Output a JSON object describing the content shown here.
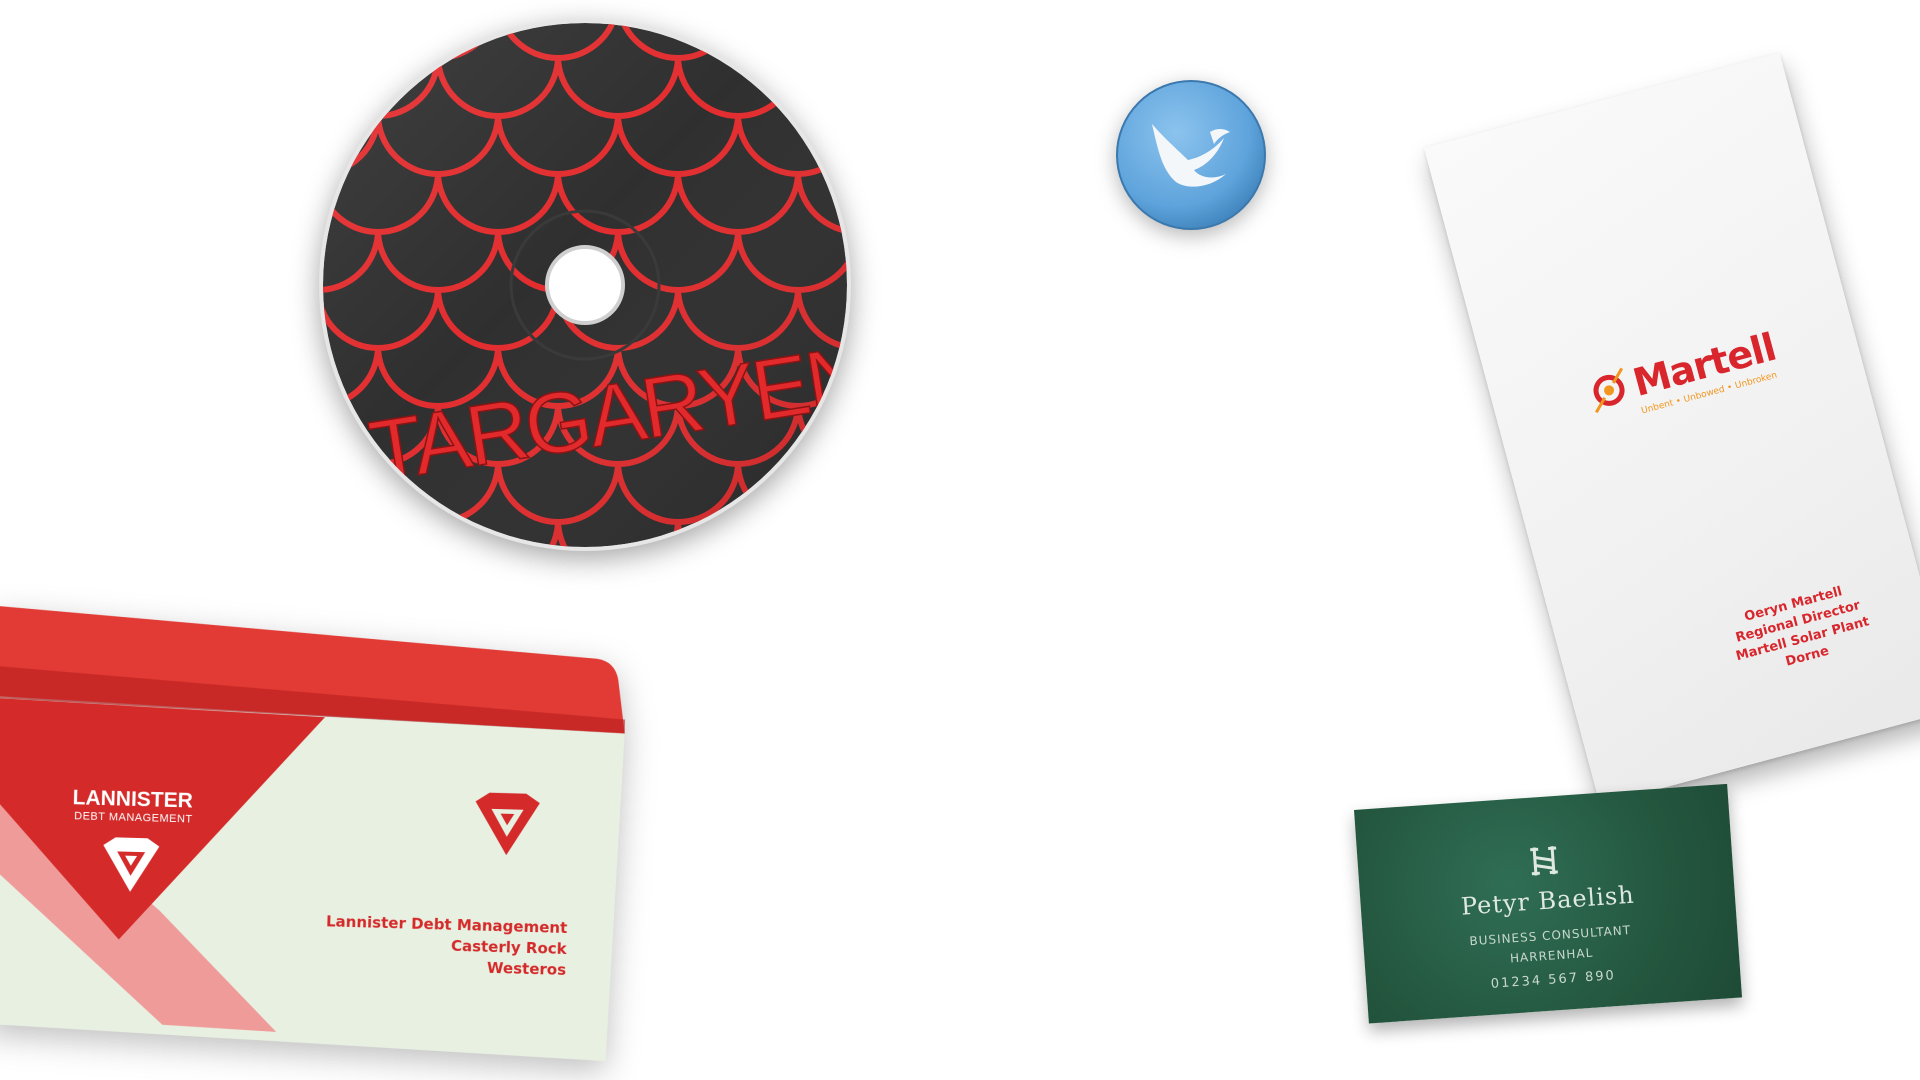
{
  "cd": {
    "title": "TARGARYEN",
    "colors": {
      "disc": "#2b2b2b",
      "scales": "#e2292b",
      "rim": "#e8e8e8"
    }
  },
  "badge": {
    "icon": "bird-wing-icon",
    "colors": {
      "face": "#5fa4dc",
      "symbol": "#ffffff"
    }
  },
  "envelope": {
    "brand_name": "LANNISTER",
    "brand_sub": "DEBT MANAGEMENT",
    "logo_icon": "lion-gem-icon",
    "address": [
      "Lannister Debt Management",
      "Casterly Rock",
      "Westeros"
    ],
    "colors": {
      "primary": "#d42a2a",
      "paper": "#e8f0e2",
      "light_band": "#f08c8c"
    }
  },
  "martell_card": {
    "brand_name": "Martell",
    "tagline": "Unbent • Unbowed • Unbroken",
    "logo_icon": "sun-spear-icon",
    "address": [
      "Oeryn Martell",
      "Regional Director",
      "Martell Solar Plant",
      "Dorne"
    ],
    "colors": {
      "brand": "#d8262c",
      "accent": "#f2961f"
    }
  },
  "baelish_card": {
    "logo_icon": "ladder-icon",
    "name": "Petyr Baelish",
    "title": "BUSINESS CONSULTANT",
    "location": "HARRENHAL",
    "phone": "01234 567 890",
    "colors": {
      "card": "#24573f",
      "text": "#dfe9e2"
    }
  }
}
